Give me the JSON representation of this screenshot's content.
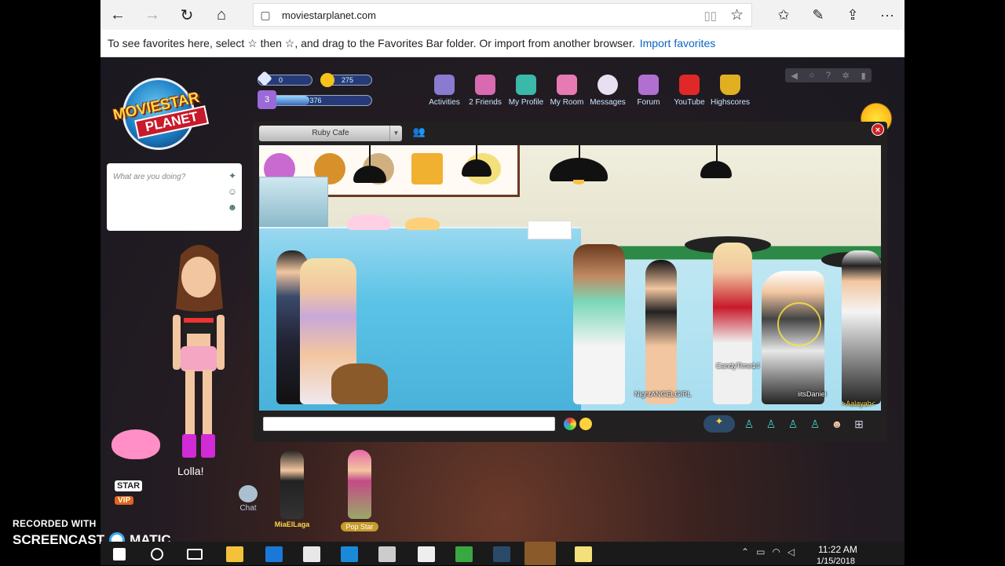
{
  "browser": {
    "url": "moviestarplanet.com",
    "favbar_text": "To see favorites here, select ☆ then ☆, and drag to the Favorites Bar folder. Or import from another browser.",
    "import_link": "Import favorites"
  },
  "game": {
    "logo": {
      "line1": "MOVIESTAR",
      "line2": "PLANET"
    },
    "stats": {
      "diamonds": "0",
      "coins": "275",
      "level": "3",
      "fame": "376",
      "level_progress_fraction": 0.45
    },
    "nav": [
      {
        "label": "Activities"
      },
      {
        "label": "2 Friends"
      },
      {
        "label": "My Profile"
      },
      {
        "label": "My Room"
      },
      {
        "label": "Messages"
      },
      {
        "label": "Forum"
      },
      {
        "label": "YouTube"
      },
      {
        "label": "Highscores"
      }
    ],
    "status_placeholder": "What are you doing?",
    "avatar_name": "Lolla!",
    "vip": {
      "line1": "STAR",
      "line2": "VIP"
    },
    "chat_tab": "Chat",
    "friends": [
      {
        "name": "MiaElLaga"
      },
      {
        "name": "Pop Star"
      }
    ],
    "room": {
      "name": "Ruby Cafe",
      "close": "×",
      "npcs": [
        {
          "name": "NightANGELGIRL"
        },
        {
          "name": "CandyTime14"
        },
        {
          "name": "iitsDaniel"
        },
        {
          "name": ">Aalayah<"
        }
      ]
    }
  },
  "watermark": {
    "line1": "RECORDED WITH",
    "line2a": "SCREENCAST",
    "line2b": "MATIC"
  },
  "taskbar": {
    "time": "11:22 AM",
    "date": "1/15/2018"
  },
  "colors": {
    "accent": "#0a64c6",
    "close_red": "#d02020",
    "npc_label": "#ffffff"
  }
}
